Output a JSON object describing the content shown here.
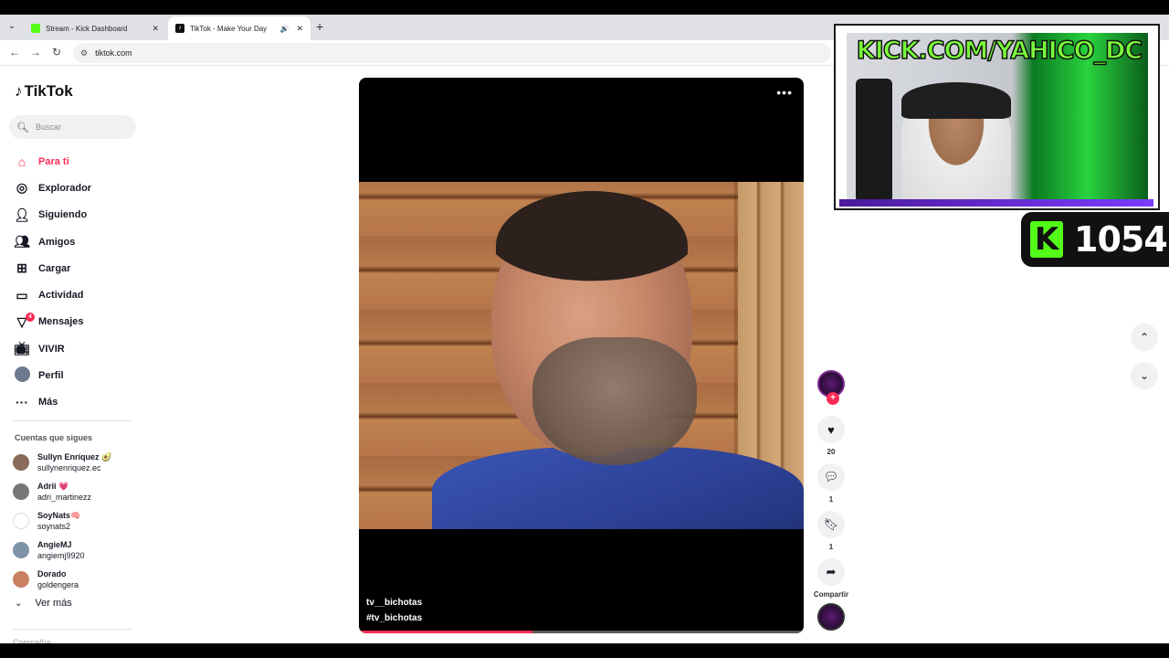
{
  "browser": {
    "tabs": [
      {
        "title": "Stream - Kick Dashboard",
        "favicon": "kick-icon"
      },
      {
        "title": "TikTok - Make Your Day",
        "favicon": "tiktok-icon",
        "audio": true,
        "active": true
      }
    ],
    "url": "tiktok.com"
  },
  "tiktok": {
    "logo": "TikTok",
    "search_placeholder": "Buscar",
    "menu": [
      {
        "label": "Para ti",
        "icon": "home-icon",
        "active": true
      },
      {
        "label": "Explorador",
        "icon": "compass-icon"
      },
      {
        "label": "Siguiendo",
        "icon": "following-icon"
      },
      {
        "label": "Amigos",
        "icon": "friends-icon"
      },
      {
        "label": "Cargar",
        "icon": "upload-icon"
      },
      {
        "label": "Actividad",
        "icon": "activity-icon"
      },
      {
        "label": "Mensajes",
        "icon": "messages-icon",
        "badge": "4"
      },
      {
        "label": "VIVIR",
        "icon": "live-icon"
      },
      {
        "label": "Perfil",
        "icon": "profile-avatar"
      },
      {
        "label": "Más",
        "icon": "more-icon"
      }
    ],
    "following_title": "Cuentas que sigues",
    "following": [
      {
        "name": "Sullyn Enríquez 🥑",
        "user": "sullynenriquez.ec",
        "color": "#8a6a5a"
      },
      {
        "name": "Adrii 💗",
        "user": "adri_martinezz",
        "color": "#777777"
      },
      {
        "name": "SoyNats🧠",
        "user": "soynats2",
        "color": "#ffffff"
      },
      {
        "name": "AngieMJ",
        "user": "angiemj9920",
        "color": "#7f93a8"
      },
      {
        "name": "Dorado",
        "user": "goldengera",
        "color": "#c98060"
      }
    ],
    "ver_mas": "Ver más",
    "company": "Compañía"
  },
  "video": {
    "username": "tv__bichotas",
    "hashtag": "#tv_bichotas",
    "progress": 0.39,
    "likes": "20",
    "comments": "1",
    "saves": "1",
    "share_label": "Compartir"
  },
  "stream_overlay": {
    "banner": "KICK.COM/YAHICO_DC",
    "viewers": "1054",
    "kick_logo": "K"
  },
  "colors": {
    "accent": "#fe2c55",
    "kick_green": "#53fc18"
  }
}
